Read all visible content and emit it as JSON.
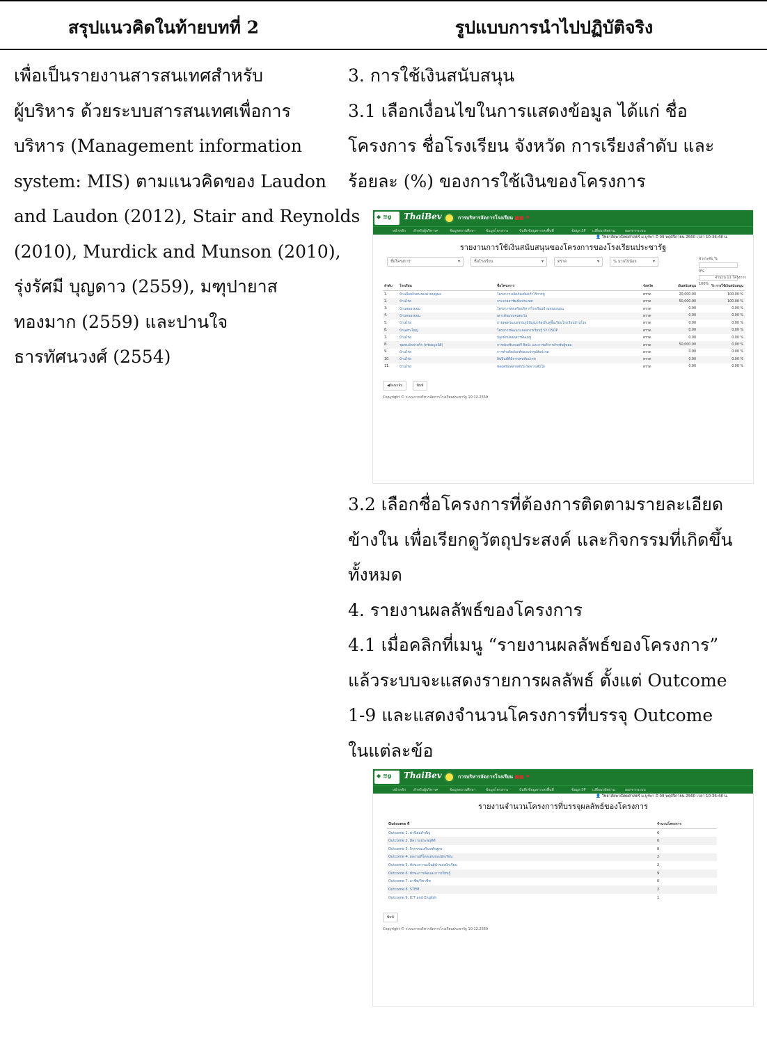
{
  "headers": {
    "left": "สรุปแนวคิดในท้ายบทที่ 2",
    "right": "รูปแบบการนำไปปฏิบัติจริง"
  },
  "left_lines": [
    "เพื่อเป็นรายงานสารสนเทศสำหรับ",
    "ผู้บริหาร ด้วยระบบสารสนเทศเพื่อการ",
    "บริหาร (Management information",
    "system: MIS) ตามแนวคิดของ Laudon",
    "and Laudon (2012), Stair and Reynolds",
    "(2010), Murdick and Munson (2010),",
    "รุ่งรัศมี บุญดาว (2559), มฑุปายาส",
    "ทองมาก (2559) และปานใจ",
    "ธารทัศนวงศ์ (2554)"
  ],
  "right_top_lines": [
    "3.  การใช้เงินสนับสนุน",
    "3.1  เลือกเงื่อนไขในการแสดงข้อมูล ได้แก่ ชื่อ",
    "โครงการ ชื่อโรงเรียน จังหวัด การเรียงลำดับ และ",
    "ร้อยละ (%) ของการใช้เงินของโครงการ"
  ],
  "right_mid_lines": [
    "3.2  เลือกชื่อโครงการที่ต้องการติดตามรายละเอียด",
    "ข้างใน เพื่อเรียกดูวัตถุประสงค์ และกิจกรรมที่เกิดขึ้น",
    "ทั้งหมด",
    "4.  รายงานผลลัพธ์ของโครงการ",
    "4.1  เมื่อคลิกที่เมนู “รายงานผลลัพธ์ของโครงการ”",
    "แล้วระบบจะแสดงรายการผลลัพธ์ ตั้งแต่ Outcome",
    "1-9 และแสดงจำนวนโครงการที่บรรจุ Outcome",
    "ในแต่ละข้อ"
  ],
  "app": {
    "brand": "ThaiBev",
    "title": "การบริหารจัดการโรงเรียน",
    "nav": [
      "หน้าหลัก",
      "สำหรับผู้บริหาร▾",
      "ข้อมูลสถานศึกษา",
      "ข้อมูลโครงการ",
      "บันทึกข้อมูลการลงพื้นที่",
      "ข้อมูล SP",
      "เปลี่ยนรหัสผ่าน",
      "ออกจากระบบ"
    ],
    "userline": "👤 วิทยาลัยพาณิชยศาสตร์ ม.บูรพา  ⏱ 09 พฤศจิกายน 2560 เวลา 10:36:48 น.",
    "copyright": "Copyright © ระบบการบริหารจัดการโรงเรียนประชารัฐ 10.12.2559"
  },
  "report1": {
    "title": "รายงานการใช้เงินสนับสนุนของโครงการของโรงเรียนประชารัฐ",
    "filters": [
      "ชื่อโครงการ",
      "ชื่อโรงเรียน",
      "ตราด",
      "% มากไปน้อย"
    ],
    "range_label": "ช่วงระดับ %",
    "range_min": "0%",
    "range_max": "100%",
    "count": "จำนวน 11 โครงการ",
    "columns": [
      "ลำดับ",
      "โรงเรียน",
      "ชื่อโครงการ",
      "จังหวัด",
      "เงินสนับสนุน",
      "% การใช้เงินสนับสนุน"
    ],
    "rows": [
      [
        "1.",
        "บ้านป้อมกิจตนรองค่ายบุญพล",
        "โครงการ ผลิตภัณฑ์ผลกำไร้การชู",
        "ตราด",
        "20,000.00",
        "100.00 %"
      ],
      [
        "2.",
        "บ้านไร่อ",
        "กระจายสารัยเพิ่มประเทศ",
        "ตราด",
        "50,000.00",
        "100.00 %"
      ],
      [
        "3.",
        "บ้านหนองบอน",
        "โครงการส่งเสริมบริหารโรงเรียนบ้านหนองบอน",
        "ตราด",
        "0.00",
        "0.00 %"
      ],
      [
        "4.",
        "บ้านหนองบอน",
        "เลาะต้นแบบจุนตะวัน",
        "ตราด",
        "0.00",
        "0.00 %"
      ],
      [
        "5.",
        "บ้านไร่อ",
        "ถ่ายทอดวัฒนธรรมภูมิปัญญาท้องถิ่นสู่ชั้นเรียนโรงเรียนบ้านไร่อ",
        "ตราด",
        "0.00",
        "0.00 %"
      ],
      [
        "6.",
        "บ้านสระใหญ่",
        "โครงการพัฒนาแหล่งการเรียนรู้ SY OSOP",
        "ตราด",
        "0.00",
        "0.00 %"
      ],
      [
        "7.",
        "บ้านไร่อ",
        "ปลูกผักปลอดสารพิษเมนู",
        "ตราด",
        "0.00",
        "0.00 %"
      ],
      [
        "8.",
        "ชุมชนวัดท่าพริก (ทรัพยมูลนิธิ)",
        "การส่งเสริมดนตรี ศิลปะ และการบริการสำหรับผู้หอม",
        "ตราด",
        "50,000.00",
        "0.00 %"
      ],
      [
        "9.",
        "บ้านไร่อ",
        "การทำผลิตภัณฑ์ของแปรรูปสับปะรด",
        "ตราด",
        "0.00",
        "0.00 %"
      ],
      [
        "10.",
        "บ้านไร่อ",
        "สินปินฟ์ที่มีจากเศษสับปะรด",
        "ตราด",
        "0.00",
        "0.00 %"
      ],
      [
        "11.",
        "บ้านไร่อ",
        "หลอดพิมพ์ลายสับปะรดจากเส้นใย",
        "ตราด",
        "0.00",
        "0.00 %"
      ]
    ],
    "buttons": [
      "◀ย้อนกลับ",
      "พิมพ์"
    ]
  },
  "report2": {
    "title": "รายงานจำนวนโครงการที่บรรจุผลลัพธ์ของโครงการ",
    "columns": [
      "Outcome ที่",
      "จำนวนโครงการ"
    ],
    "rows": [
      [
        "Outcome 1. ค่านิยมสำคัญ",
        "6"
      ],
      [
        "Outcome 2. มีความประพฤติดี",
        "0"
      ],
      [
        "Outcome 3. กิจกรรมเสริมหลักสูตร",
        "8"
      ],
      [
        "Outcome 4. ผลงานที่โดดเด่นของนักเรียน",
        "2"
      ],
      [
        "Outcome 5. ทักษะความเป็นผู้นำของนักเรียน",
        "2"
      ],
      [
        "Outcome 6. ทักษะการคิดและการเรียนรู้",
        "9"
      ],
      [
        "Outcome 7. อาชีพ/วิชาชีพ",
        "0"
      ],
      [
        "Outcome 8. STEM",
        "2"
      ],
      [
        "Outcome 9. ICT and English",
        "1"
      ]
    ],
    "buttons": [
      "พิมพ์"
    ]
  }
}
